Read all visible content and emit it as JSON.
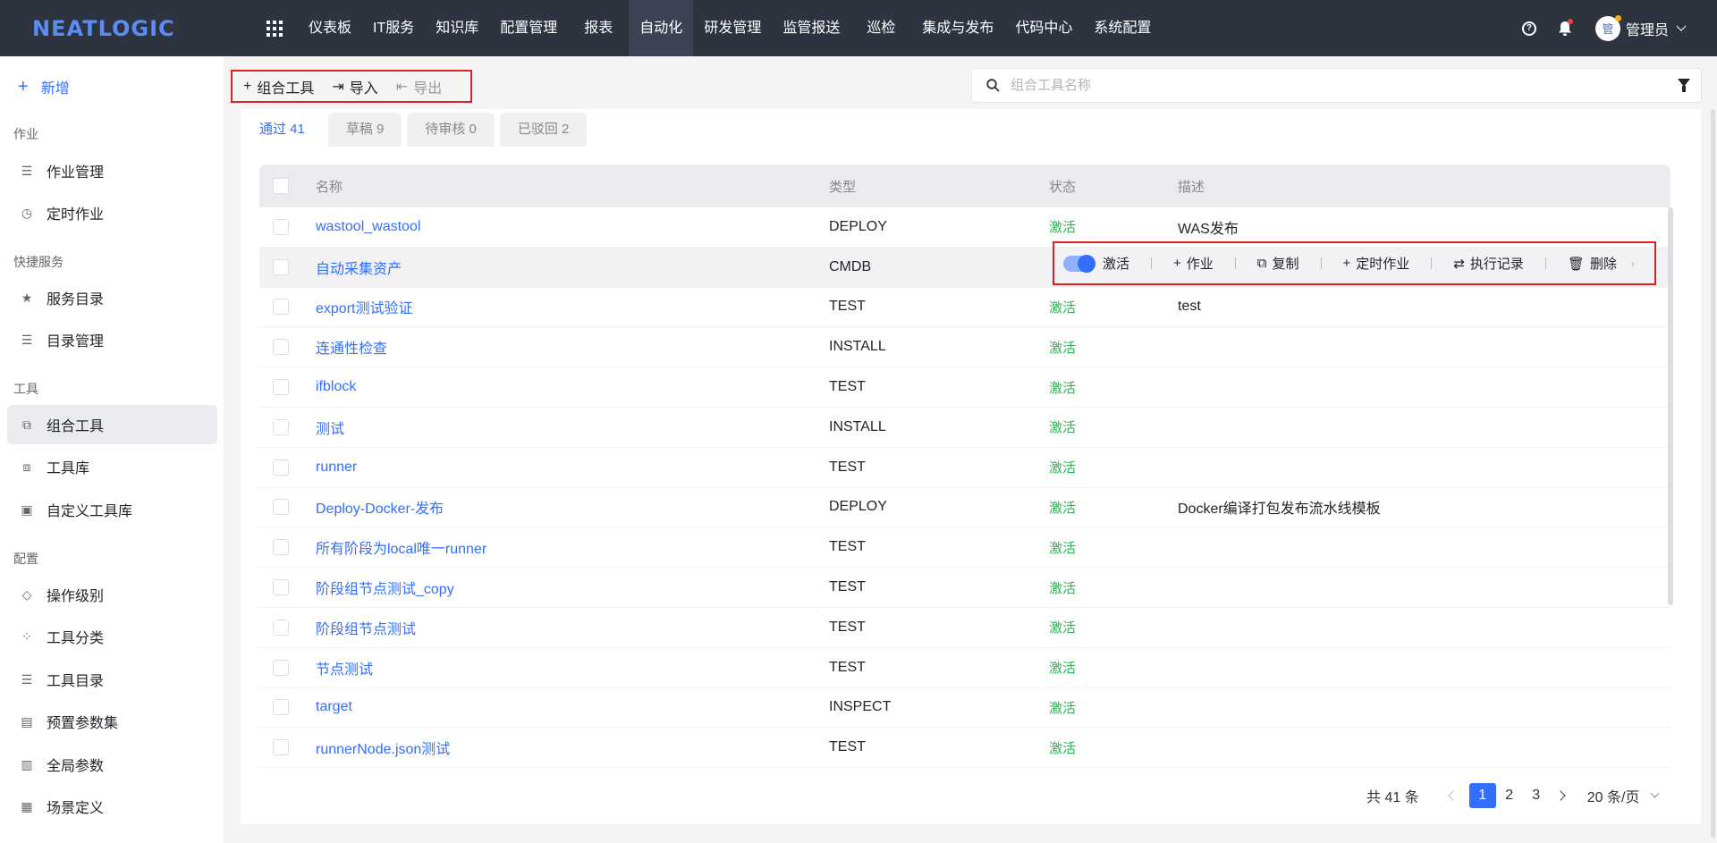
{
  "header": {
    "logo": "NEATLOGIC",
    "nav": [
      "仪表板",
      "IT服务",
      "知识库",
      "配置管理",
      "报表",
      "自动化",
      "研发管理",
      "监管报送",
      "巡检",
      "集成与发布",
      "代码中心",
      "系统配置"
    ],
    "active_nav_index": 5,
    "help_glyph": "?",
    "avatar_text": "管",
    "user": "管理员"
  },
  "sidebar": {
    "add_label": "新增",
    "groups": [
      {
        "label": "作业",
        "items": [
          {
            "label": "作业管理",
            "icon": "job-list-icon"
          },
          {
            "label": "定时作业",
            "icon": "clock-icon"
          }
        ]
      },
      {
        "label": "快捷服务",
        "items": [
          {
            "label": "服务目录",
            "icon": "star-icon"
          },
          {
            "label": "目录管理",
            "icon": "list-icon"
          }
        ]
      },
      {
        "label": "工具",
        "items": [
          {
            "label": "组合工具",
            "icon": "combo-tool-icon",
            "active": true
          },
          {
            "label": "工具库",
            "icon": "toolbox-icon"
          },
          {
            "label": "自定义工具库",
            "icon": "custom-toolbox-icon"
          }
        ]
      },
      {
        "label": "配置",
        "items": [
          {
            "label": "操作级别",
            "icon": "diamond-icon"
          },
          {
            "label": "工具分类",
            "icon": "grid-icon"
          },
          {
            "label": "工具目录",
            "icon": "list-icon"
          },
          {
            "label": "预置参数集",
            "icon": "document-icon"
          },
          {
            "label": "全局参数",
            "icon": "chart-icon"
          },
          {
            "label": "场景定义",
            "icon": "clapper-icon"
          }
        ]
      }
    ]
  },
  "toolbar": {
    "add": "组合工具",
    "import": "导入",
    "export": "导出"
  },
  "search": {
    "placeholder": "组合工具名称"
  },
  "tabs": [
    {
      "label": "通过 41",
      "active": true
    },
    {
      "label": "草稿 9"
    },
    {
      "label": "待审核 0"
    },
    {
      "label": "已驳回 2"
    }
  ],
  "table": {
    "columns": [
      "名称",
      "类型",
      "状态",
      "描述"
    ],
    "rows": [
      {
        "name": "wastool_wastool",
        "type": "DEPLOY",
        "status": "激活",
        "desc": "WAS发布"
      },
      {
        "name": "自动采集资产",
        "type": "CMDB",
        "status": "激活",
        "desc": ""
      },
      {
        "name": "export测试验证",
        "type": "TEST",
        "status": "激活",
        "desc": "test"
      },
      {
        "name": "连通性检查",
        "type": "INSTALL",
        "status": "激活",
        "desc": ""
      },
      {
        "name": "ifblock",
        "type": "TEST",
        "status": "激活",
        "desc": ""
      },
      {
        "name": "测试",
        "type": "INSTALL",
        "status": "激活",
        "desc": ""
      },
      {
        "name": "runner",
        "type": "TEST",
        "status": "激活",
        "desc": ""
      },
      {
        "name": "Deploy-Docker-发布",
        "type": "DEPLOY",
        "status": "激活",
        "desc": "Docker编译打包发布流水线模板"
      },
      {
        "name": "所有阶段为local唯一runner",
        "type": "TEST",
        "status": "激活",
        "desc": ""
      },
      {
        "name": "阶段组节点测试_copy",
        "type": "TEST",
        "status": "激活",
        "desc": ""
      },
      {
        "name": "阶段组节点测试",
        "type": "TEST",
        "status": "激活",
        "desc": ""
      },
      {
        "name": "节点测试",
        "type": "TEST",
        "status": "激活",
        "desc": ""
      },
      {
        "name": "target",
        "type": "INSPECT",
        "status": "激活",
        "desc": ""
      },
      {
        "name": "runnerNode.json测试",
        "type": "TEST",
        "status": "激活",
        "desc": ""
      }
    ]
  },
  "row_actions": {
    "toggle": "激活",
    "job": "作业",
    "copy": "复制",
    "schedule": "定时作业",
    "history": "执行记录",
    "delete": "删除"
  },
  "pagination": {
    "total": "共 41 条",
    "pages": [
      "1",
      "2",
      "3"
    ],
    "current": "1",
    "page_size": "20 条/页"
  },
  "colors": {
    "accent": "#336eff",
    "status_active": "#25b84e",
    "highlight_box": "#e02020",
    "topbar": "#2e3340"
  }
}
